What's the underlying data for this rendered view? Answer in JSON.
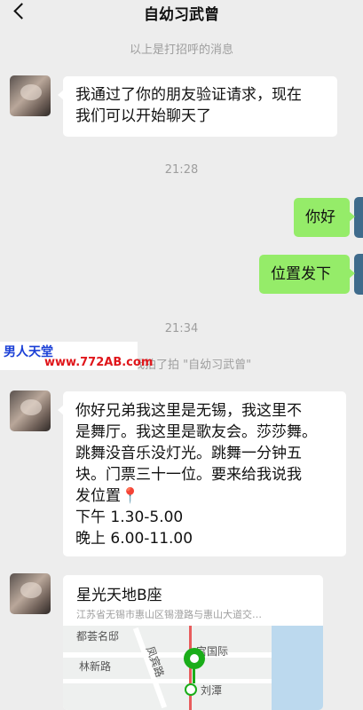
{
  "header": {
    "title": "自幼习武曾"
  },
  "system": {
    "greeting_note": "以上是打招呼的消息",
    "time_1": "21:28",
    "time_2": "21:34",
    "pat_note": "我拍了拍 \"自幼习武曾\""
  },
  "messages": {
    "m1": {
      "line1": "我通过了你的朋友验证请求，现在",
      "line2": "我们可以开始聊天了"
    },
    "m2": {
      "text": "你好"
    },
    "m3": {
      "text": "位置发下"
    },
    "m4": {
      "line1": "你好兄弟我这里是无锡，我这里不",
      "line2": "是舞厅。我这里是歌友会。莎莎舞。",
      "line3": "跳舞没音乐没灯光。跳舞一分钟五",
      "line4": "块。门票三十一位。要来给我说我",
      "line5": "发位置📍",
      "line6": "下午 1.30-5.00",
      "line7": "晚上 6.00-11.00"
    },
    "location": {
      "title": "星光天地B座",
      "address": "江苏省无锡市惠山区锡澄路与惠山大道交…",
      "map_labels": [
        "都荟名邸",
        "林新路",
        "凤宾路",
        "宫国际",
        "刘潭"
      ]
    }
  },
  "watermark": {
    "line1": "男人天堂",
    "line2": "www.772AB.com"
  },
  "colors": {
    "background": "#ededed",
    "outgoing_bubble": "#95ec69",
    "incoming_bubble": "#ffffff",
    "map_pin": "#1aad19"
  }
}
